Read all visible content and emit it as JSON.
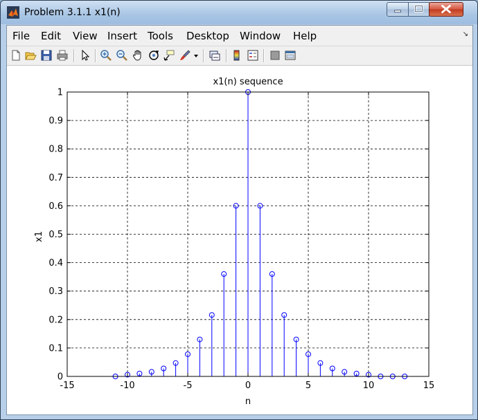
{
  "window": {
    "title": "Problem 3.1.1 x1(n)"
  },
  "menu": {
    "items": [
      "File",
      "Edit",
      "View",
      "Insert",
      "Tools",
      "Desktop",
      "Window",
      "Help"
    ]
  },
  "toolbar": {
    "icons": [
      "new-figure-icon",
      "open-file-icon",
      "save-icon",
      "print-icon",
      "edit-plot-arrow-icon",
      "zoom-in-icon",
      "zoom-out-icon",
      "pan-hand-icon",
      "rotate-3d-icon",
      "data-cursor-icon",
      "brush-icon",
      "brush-dropdown-icon",
      "link-plot-icon",
      "colorbar-icon",
      "legend-icon",
      "hide-plot-tools-icon",
      "show-plot-tools-icon"
    ]
  },
  "colors": {
    "stem": "#0000ff",
    "axes": "#000000",
    "grid": "#000000"
  },
  "chart_data": {
    "type": "stem",
    "title": "x1(n) sequence",
    "xlabel": "n",
    "ylabel": "x1",
    "xlim": [
      -15,
      15
    ],
    "ylim": [
      0,
      1
    ],
    "xticks": [
      -15,
      -10,
      -5,
      0,
      5,
      10,
      15
    ],
    "yticks": [
      0,
      0.1,
      0.2,
      0.3,
      0.4,
      0.5,
      0.6,
      0.7,
      0.8,
      0.9,
      1
    ],
    "grid": true,
    "marker": "circle",
    "x": [
      -11,
      -10,
      -9,
      -8,
      -7,
      -6,
      -5,
      -4,
      -3,
      -2,
      -1,
      0,
      1,
      2,
      3,
      4,
      5,
      6,
      7,
      8,
      9,
      10,
      11,
      12,
      13
    ],
    "y": [
      0.0,
      0.006,
      0.01,
      0.016,
      0.028,
      0.047,
      0.078,
      0.13,
      0.216,
      0.36,
      0.6,
      1.0,
      0.6,
      0.36,
      0.216,
      0.13,
      0.078,
      0.047,
      0.028,
      0.016,
      0.01,
      0.006,
      0.0,
      0.0,
      0.0
    ]
  }
}
